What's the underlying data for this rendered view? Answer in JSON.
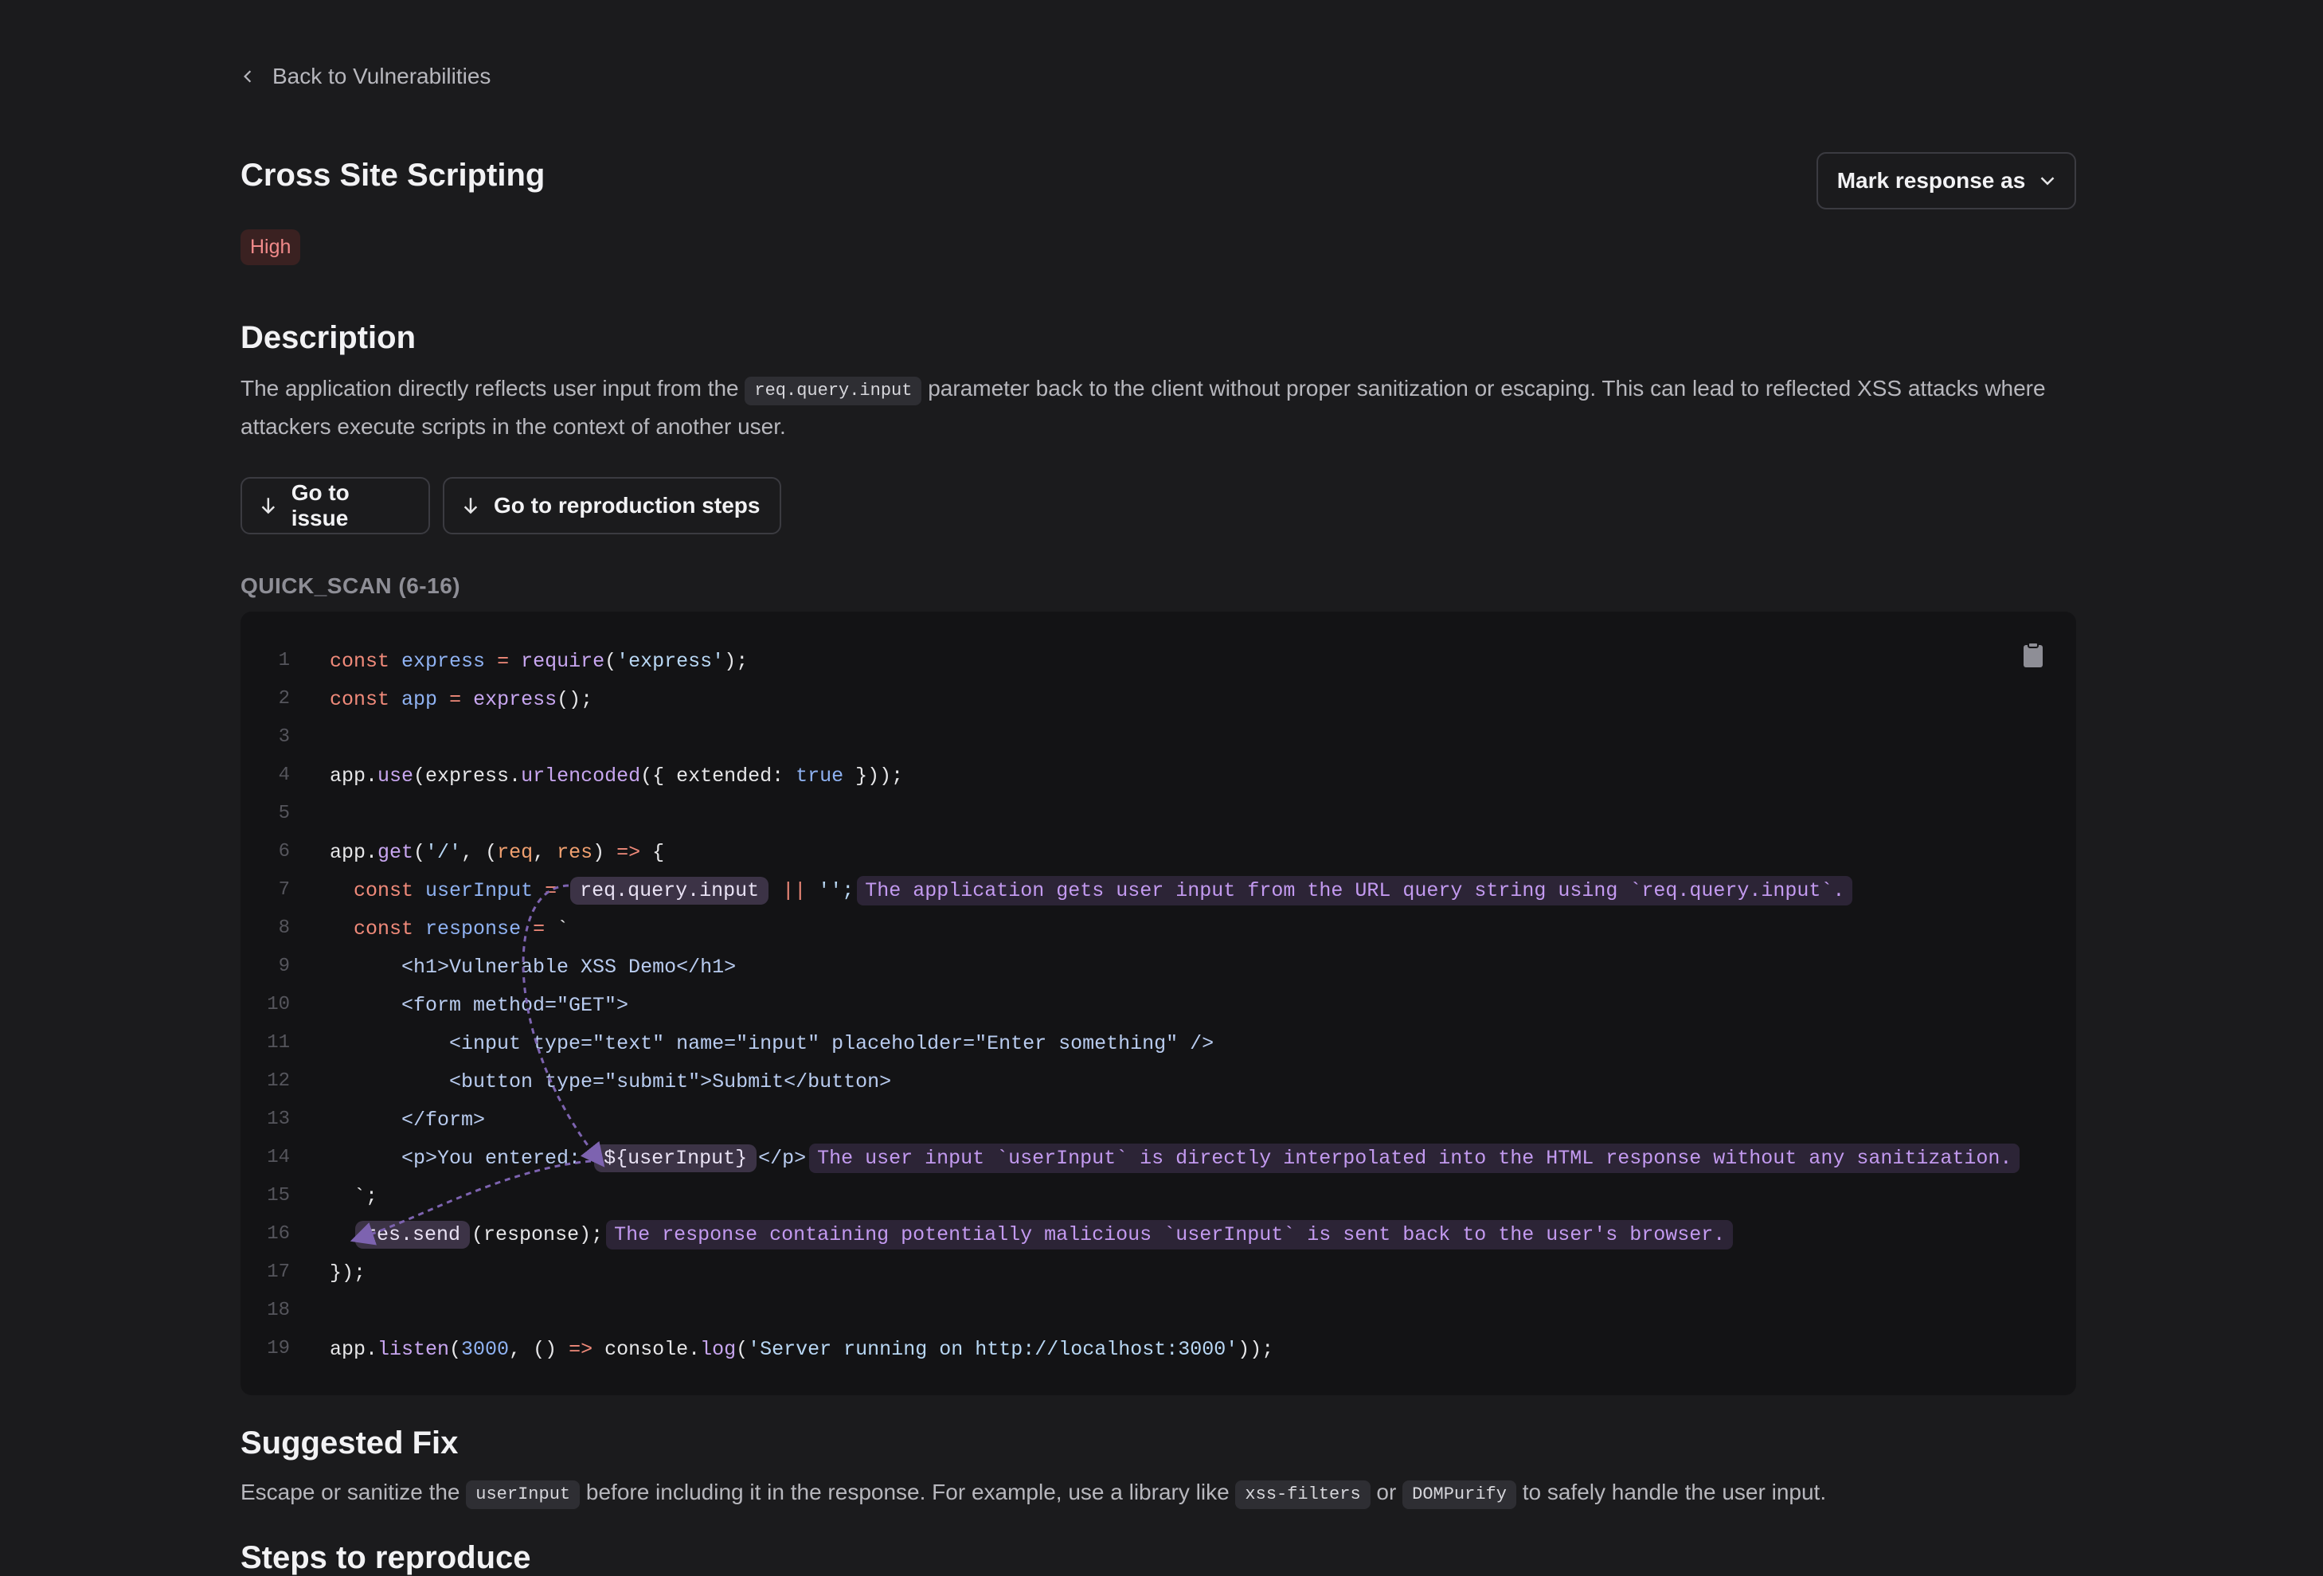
{
  "nav": {
    "back_label": "Back to Vulnerabilities"
  },
  "header": {
    "title": "Cross Site Scripting",
    "severity": "High",
    "mark_label": "Mark response as"
  },
  "description": {
    "heading": "Description",
    "text_before": "The application directly reflects user input from the ",
    "code": "req.query.input",
    "text_after": " parameter back to the client without proper sanitization or escaping. This can lead to reflected XSS attacks where attackers execute scripts in the context of another user."
  },
  "actions": {
    "go_to_issue": "Go to issue",
    "go_to_steps": "Go to reproduction steps"
  },
  "scan": {
    "label": "QUICK_SCAN (6-16)"
  },
  "code": {
    "line_numbers": [
      "1",
      "2",
      "3",
      "4",
      "5",
      "6",
      "7",
      "8",
      "9",
      "10",
      "11",
      "12",
      "13",
      "14",
      "15",
      "16",
      "17",
      "18",
      "19"
    ],
    "l1": {
      "kw": "const",
      "name": "express",
      "eq": "=",
      "fn": "require",
      "rest1": "(",
      "str": "'express'",
      "rest2": ");"
    },
    "l2": {
      "kw": "const",
      "name": "app",
      "eq": "=",
      "fn": "express",
      "rest": "();"
    },
    "l4": {
      "a": "app.",
      "fn1": "use",
      "b": "(express.",
      "fn2": "urlencoded",
      "c": "({ extended: ",
      "val": "true",
      "d": " }));"
    },
    "l6": {
      "a": "app.",
      "fn": "get",
      "b": "(",
      "str": "'/'",
      "c": ", (",
      "p1": "req",
      "d": ", ",
      "p2": "res",
      "e": ") ",
      "arrow": "=>",
      "f": " {"
    },
    "l7": {
      "kw": "const",
      "name": "userInput",
      "eq": "=",
      "pill": "req.query.input",
      "op": "||",
      "str": "'';",
      "note": "The application gets user input from the URL query string using `req.query.input`."
    },
    "l8": {
      "kw": "const",
      "name": "response",
      "eq": "=",
      "tick": "`"
    },
    "l9": "<h1>Vulnerable XSS Demo</h1>",
    "l10": "<form method=\"GET\">",
    "l11": "<input type=\"text\" name=\"input\" placeholder=\"Enter something\" />",
    "l12": "<button type=\"submit\">Submit</button>",
    "l13": "</form>",
    "l14": {
      "a": "<p>You entered: ",
      "pill": "${userInput}",
      "b": "</p>",
      "note": "The user input `userInput` is directly interpolated into the HTML response without any sanitization."
    },
    "l15": "`;",
    "l16": {
      "pill": "res.send",
      "rest": "(response);",
      "note": "The response containing potentially malicious `userInput` is sent back to the user's browser."
    },
    "l17": "});",
    "l19": {
      "a": "app.",
      "fn": "listen",
      "b": "(",
      "num": "3000",
      "c": ", () ",
      "arrow": "=>",
      "d": " console.",
      "fn2": "log",
      "e": "(",
      "str": "'Server running on http://localhost:3000'",
      "f": "));"
    }
  },
  "fix": {
    "heading": "Suggested Fix",
    "t1": "Escape or sanitize the ",
    "c1": "userInput",
    "t2": " before including it in the response. For example, use a library like ",
    "c2": "xss-filters",
    "t3": " or ",
    "c3": "DOMPurify",
    "t4": " to safely handle the user input."
  },
  "steps": {
    "heading": "Steps to reproduce"
  },
  "colors": {
    "background": "#1b1b1d",
    "code_bg": "#131315",
    "severity_bg": "#3a2121",
    "severity_text": "#f08a8a",
    "annotation": "#c39af0"
  },
  "icons": [
    "chevron-left-icon",
    "chevron-down-icon",
    "arrow-down-icon",
    "clipboard-icon"
  ]
}
